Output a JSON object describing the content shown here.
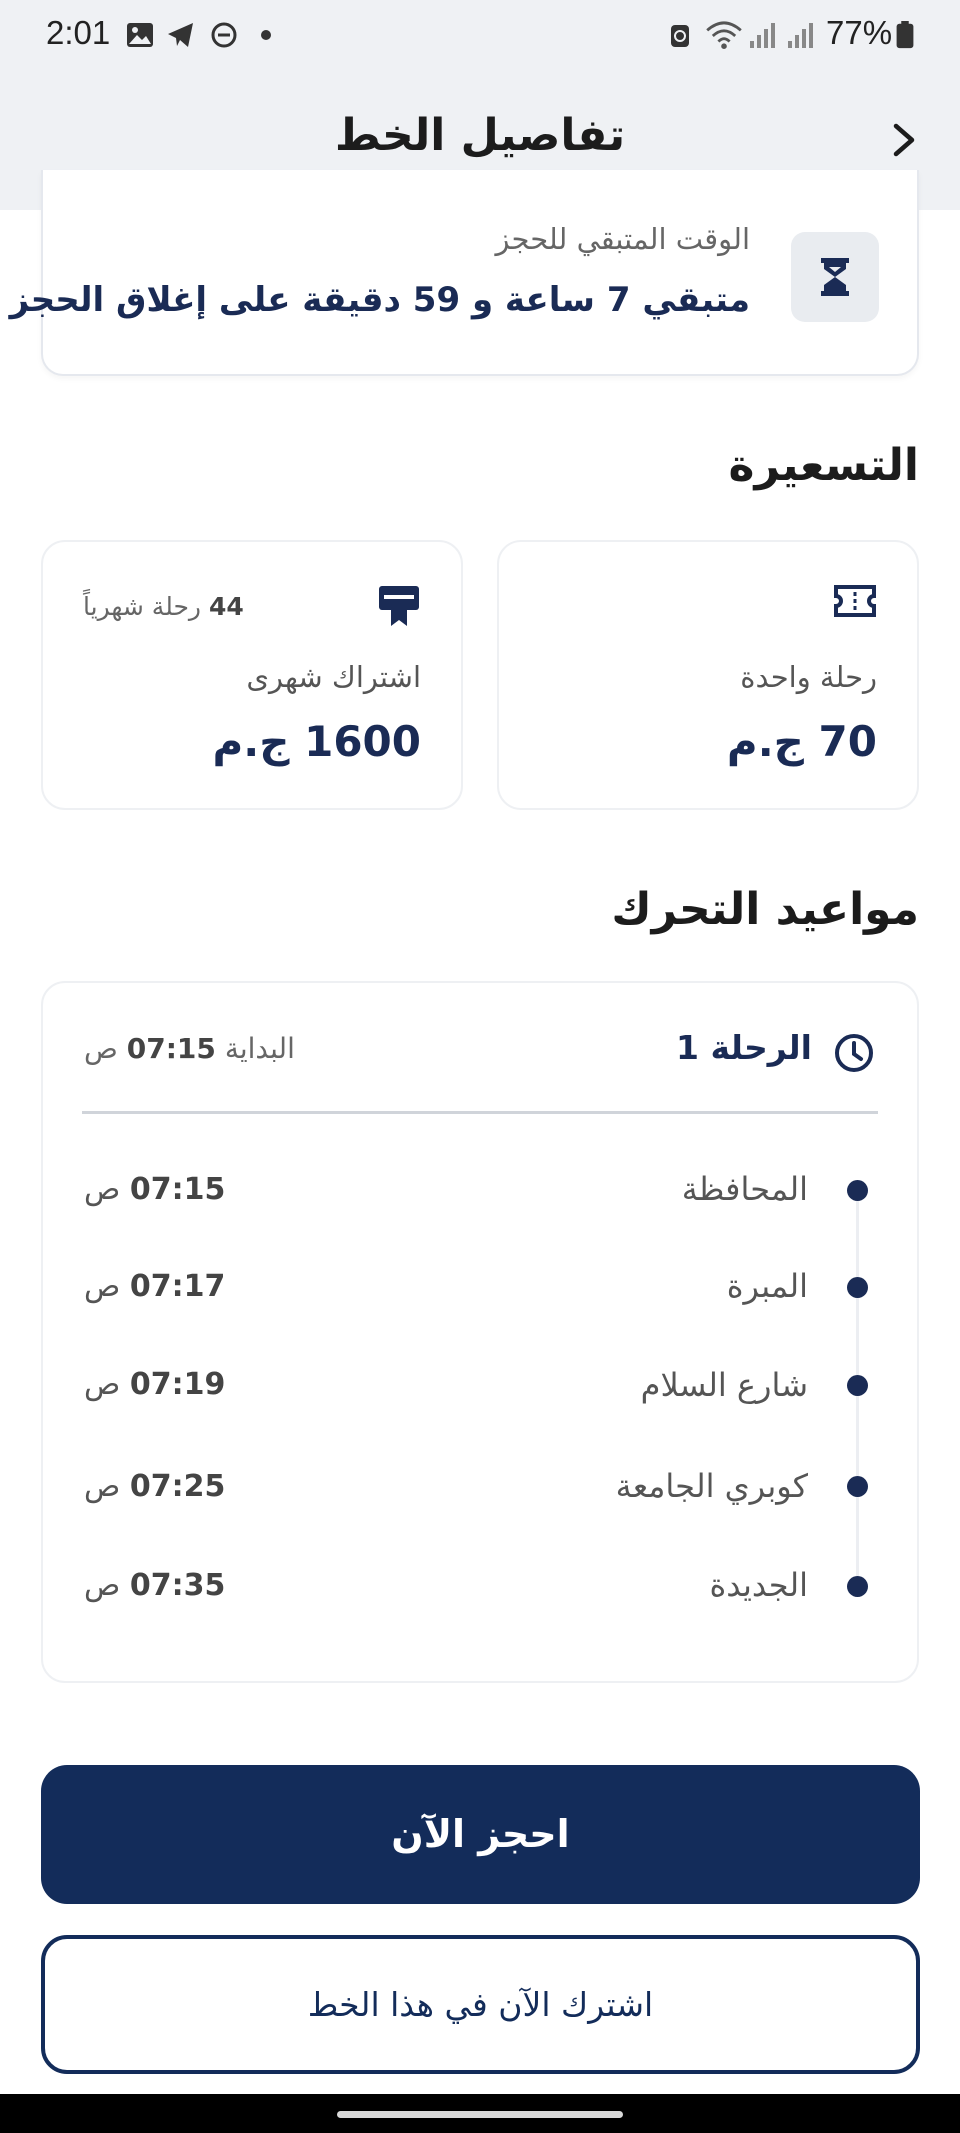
{
  "status_bar": {
    "time": "2:01",
    "battery": "77%",
    "icons": [
      "gallery-icon",
      "telegram-icon",
      "dnd-icon",
      "dot-icon",
      "sync-icon",
      "wifi-icon",
      "signal-icon",
      "signal-icon",
      "battery-icon"
    ]
  },
  "header": {
    "title": "تفاصيل الخط",
    "back_icon": "chevron-right-icon"
  },
  "booking": {
    "label": "الوقت المتبقي للحجز",
    "value": "متبقي 7 ساعة و 59 دقيقة على إغلاق الحجز",
    "icon": "hourglass-icon"
  },
  "pricing": {
    "title": "التسعيرة",
    "single": {
      "label": "رحلة واحدة",
      "price": "70 ج.م",
      "icon": "ticket-icon"
    },
    "monthly": {
      "label": "اشتراك شهرى",
      "price": "1600 ج.م",
      "trips_count": "44",
      "trips_text": "رحلة شهرياً",
      "icon": "card-badge-icon"
    }
  },
  "schedule": {
    "title": "مواعيد التحرك",
    "trip": {
      "title": "الرحلة 1",
      "start_label": "البداية",
      "start_time": "07:15",
      "start_suffix": "ص",
      "icon": "clock-icon"
    },
    "stops": [
      {
        "name": "المحافظة",
        "time": "07:15",
        "suffix": "ص"
      },
      {
        "name": "المبرة",
        "time": "07:17",
        "suffix": "ص"
      },
      {
        "name": "شارع السلام",
        "time": "07:19",
        "suffix": "ص"
      },
      {
        "name": "كوبري الجامعة",
        "time": "07:25",
        "suffix": "ص"
      },
      {
        "name": "الجديدة",
        "time": "07:35",
        "suffix": "ص"
      }
    ]
  },
  "actions": {
    "book_now": "احجز الآن",
    "subscribe": "اشترك الآن في هذا الخط"
  },
  "colors": {
    "primary": "#132c5a",
    "accent_text": "#1a2b55",
    "header_bg": "#eff1f4"
  }
}
